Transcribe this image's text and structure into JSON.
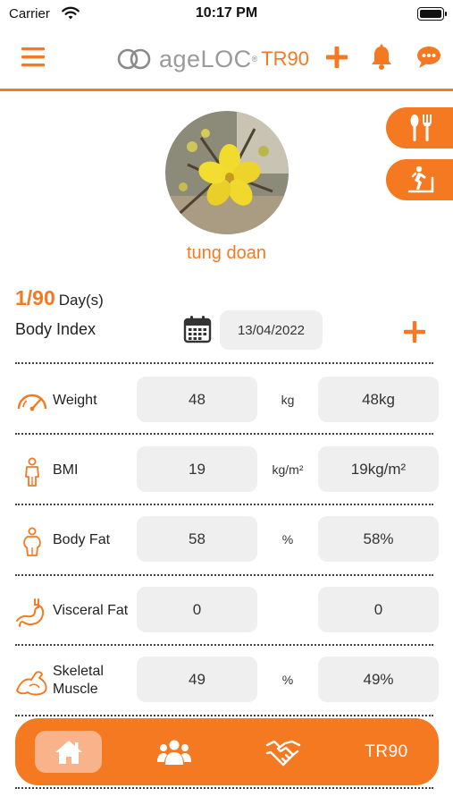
{
  "status_bar": {
    "carrier": "Carrier",
    "time": "10:17 PM"
  },
  "header": {
    "logo_text": "ageLOC",
    "logo_reg": "®",
    "logo_product": "TR90",
    "icons": [
      "menu-icon",
      "plus-icon",
      "bell-icon",
      "chat-icon"
    ]
  },
  "side_buttons": [
    "meal-icon",
    "exercise-icon"
  ],
  "profile": {
    "name": "tung doan"
  },
  "progress": {
    "day": "1/90",
    "unit": "Day(s)"
  },
  "body_index": {
    "label": "Body Index",
    "date": "13/04/2022"
  },
  "metrics": [
    {
      "label": "Weight",
      "icon": "scale-gauge-icon",
      "value": "48",
      "unit": "kg",
      "display": "48kg"
    },
    {
      "label": "BMI",
      "icon": "body-icon",
      "value": "19",
      "unit": "kg/m²",
      "display": "19kg/m²"
    },
    {
      "label": "Body Fat",
      "icon": "body-fat-icon",
      "value": "58",
      "unit": "%",
      "display": "58%"
    },
    {
      "label": "Visceral Fat",
      "icon": "stomach-icon",
      "value": "0",
      "unit": "",
      "display": "0"
    },
    {
      "label": "Skeletal Muscle",
      "icon": "muscle-arm-icon",
      "value": "49",
      "unit": "%",
      "display": "49%"
    }
  ],
  "tabbar": {
    "tabs": [
      {
        "name": "home",
        "icon": "home-icon",
        "active": true
      },
      {
        "name": "community",
        "icon": "group-icon",
        "active": false
      },
      {
        "name": "partners",
        "icon": "handshake-icon",
        "active": false
      },
      {
        "name": "tr90",
        "label": "TR90",
        "active": false
      }
    ]
  },
  "colors": {
    "accent": "#f47920",
    "field_bg": "#efefef",
    "active_tab": "#f9b38a"
  }
}
